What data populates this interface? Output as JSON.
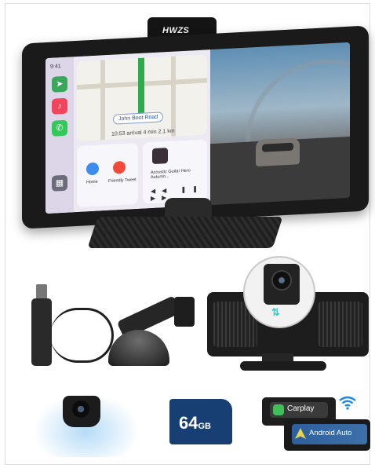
{
  "brand": {
    "text": "HWZS"
  },
  "carplay_screen": {
    "status_time": "9:41",
    "map_label": "John Boot Road",
    "eta_text": "10:53 arrival   4 min   2.1 km",
    "home_label": "Home",
    "friendly_label": "Friendly Tweet",
    "song_text": "Acoustic Guitar Hero Autumn..."
  },
  "storage": {
    "capacity": "64",
    "unit": "GB"
  },
  "connectivity": {
    "carplay_label": "Carplay",
    "android_label": "Android Auto"
  },
  "colors": {
    "carplay_green": "#3fbf5a",
    "wifi_blue": "#1e88e5",
    "sd_blue": "#173f73",
    "arrow_teal": "#2ad3cf"
  },
  "icons": [
    "maps-icon",
    "music-icon",
    "phone-icon",
    "grid-icon",
    "home-icon",
    "pin-icon",
    "wifi-icon",
    "carplay-icon",
    "android-auto-icon",
    "swap-arrows-icon"
  ]
}
